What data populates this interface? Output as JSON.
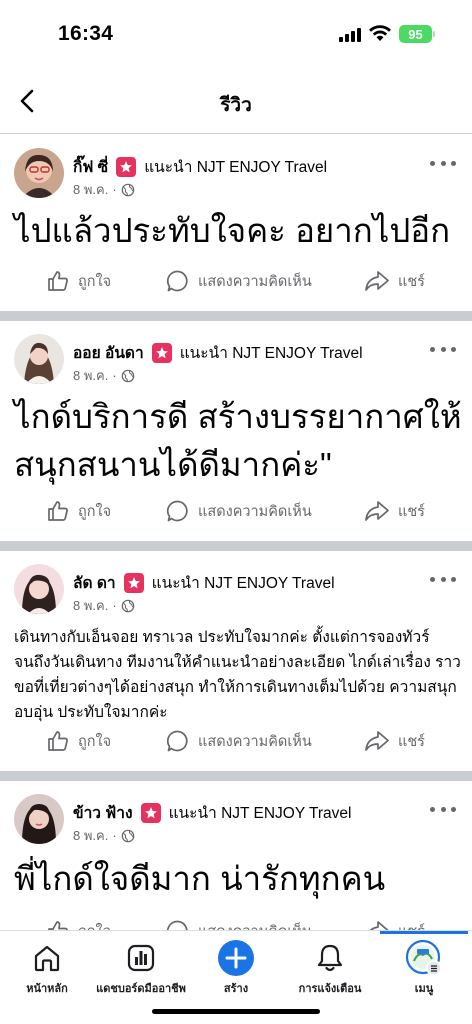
{
  "status_bar": {
    "time": "16:34",
    "battery": "95"
  },
  "header": {
    "title": "รีวิว"
  },
  "posts": [
    {
      "author": "กิ๊ฟ ซี่",
      "recommend": "แนะนำ NJT ENJOY Travel",
      "date": "8 พ.ค.",
      "text": "ไปแล้วประทับใจคะ อยากไปอีก"
    },
    {
      "author": "ออย อันดา",
      "recommend": "แนะนำ NJT ENJOY Travel",
      "date": "8 พ.ค.",
      "text": "ไกด์บริการดี สร้างบรรยากาศให้สนุกสนานได้ดีมากค่ะ\""
    },
    {
      "author": "ลัด ดา",
      "recommend": "แนะนำ NJT ENJOY Travel",
      "date": "8 พ.ค.",
      "text": "เดินทางกับเอ็นจอย ทราเวล ประทับใจมากค่ะ ตั้งแต่การจองทัวร์ จนถึงวันเดินทาง ทีมงานให้คำแนะนำอย่างละเอียด ไกด์เล่าเรื่อง ราวขอที่เที่ยวต่างๆได้อย่างสนุก  ทำให้การเดินทางเต็มไปด้วย ความสนุก อบอุ่น ประทับใจมากค่ะ"
    },
    {
      "author": "ข้าว ฟ้าง",
      "recommend": "แนะนำ NJT ENJOY Travel",
      "date": "8 พ.ค.",
      "text": "พี่ไกด์ใจดีมาก น่ารักทุกคน"
    }
  ],
  "actions": {
    "like": "ถูกใจ",
    "comment": "แสดงความคิดเห็น",
    "share": "แชร์"
  },
  "bottom_nav": [
    {
      "label": "หน้าหลัก",
      "icon": "home-icon"
    },
    {
      "label": "แดชบอร์ดมืออาชีพ",
      "icon": "dashboard-icon"
    },
    {
      "label": "สร้าง",
      "icon": "create-plus-icon"
    },
    {
      "label": "การแจ้งเตือน",
      "icon": "bell-icon"
    },
    {
      "label": "เมนู",
      "icon": "menu-avatar-icon"
    }
  ],
  "colors": {
    "accent": "#1b74e4",
    "badge": "#e7325f",
    "battery": "#4cd964",
    "separator": "#c9ccd1"
  }
}
